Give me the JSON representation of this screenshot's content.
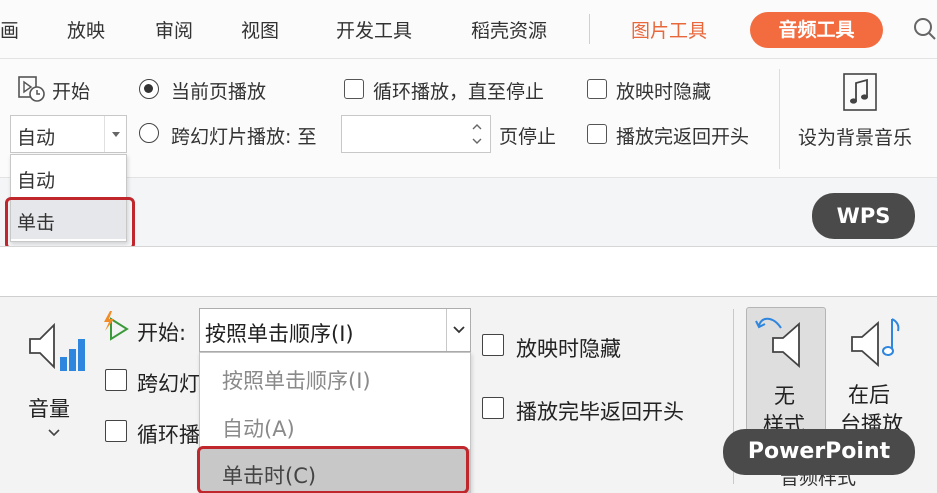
{
  "wps": {
    "tabs": [
      "画",
      "放映",
      "审阅",
      "视图",
      "开发工具",
      "稻壳资源",
      "图片工具",
      "音频工具"
    ],
    "start": {
      "label": "开始",
      "combo_value": "自动",
      "options": [
        "自动",
        "单击"
      ]
    },
    "play_mode": {
      "current_page": "当前页播放",
      "cross_slide": "跨幻灯片播放: 至",
      "page_stop": "页停止"
    },
    "checks": {
      "loop": "循环播放，直至停止",
      "hide_during_show": "放映时隐藏",
      "rewind": "播放完返回开头"
    },
    "bg_music": "设为背景音乐",
    "badge": "WPS"
  },
  "ppt": {
    "volume": "音量",
    "start_label": "开始:",
    "start_value": "按照单击顺序(I)",
    "cross_partial": "跨幻灯",
    "loop_partial": "循环播",
    "options": [
      "按照单击顺序(I)",
      "自动(A)",
      "单击时(C)"
    ],
    "hide_during_show": "放映时隐藏",
    "rewind": "播放完毕返回开头",
    "style_none_1": "无",
    "style_none_2": "样式",
    "bg_play_1": "在后",
    "bg_play_2": "台播放",
    "group_label_partial": "音频样式",
    "badge": "PowerPoint"
  }
}
